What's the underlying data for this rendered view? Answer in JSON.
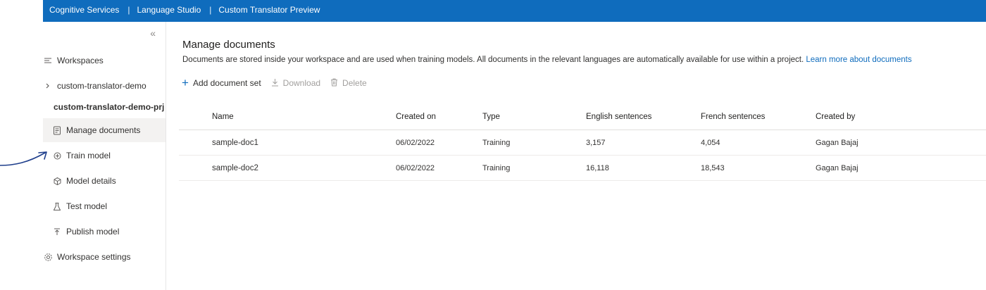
{
  "topbar": {
    "crumbs": [
      "Cognitive Services",
      "Language Studio",
      "Custom Translator Preview"
    ],
    "separator": "|"
  },
  "sidebar": {
    "collapse_glyph": "«",
    "items": [
      {
        "label": "Workspaces",
        "icon": "list-icon"
      },
      {
        "label": "custom-translator-demo",
        "icon": "chevron-icon"
      },
      {
        "label": "custom-translator-demo-prj",
        "icon": ""
      },
      {
        "label": "Manage documents",
        "icon": "document-icon"
      },
      {
        "label": "Train model",
        "icon": "train-icon"
      },
      {
        "label": "Model details",
        "icon": "cube-icon"
      },
      {
        "label": "Test model",
        "icon": "flask-icon"
      },
      {
        "label": "Publish model",
        "icon": "publish-icon"
      },
      {
        "label": "Workspace settings",
        "icon": "settings-icon"
      }
    ]
  },
  "main": {
    "title": "Manage documents",
    "description": "Documents are stored inside your workspace and are used when training models. All documents in the relevant languages are automatically available for use within a project.",
    "learn_more": "Learn more about documents",
    "toolbar": {
      "add": "Add document set",
      "download": "Download",
      "delete": "Delete"
    },
    "table": {
      "columns": [
        "Name",
        "Created on",
        "Type",
        "English sentences",
        "French sentences",
        "Created by"
      ],
      "rows": [
        [
          "sample-doc1",
          "06/02/2022",
          "Training",
          "3,157",
          "4,054",
          "Gagan Bajaj"
        ],
        [
          "sample-doc2",
          "06/02/2022",
          "Training",
          "16,118",
          "18,543",
          "Gagan Bajaj"
        ]
      ]
    }
  },
  "colors": {
    "brand": "#0f6cbd",
    "annotation": "#1f3f8c"
  }
}
